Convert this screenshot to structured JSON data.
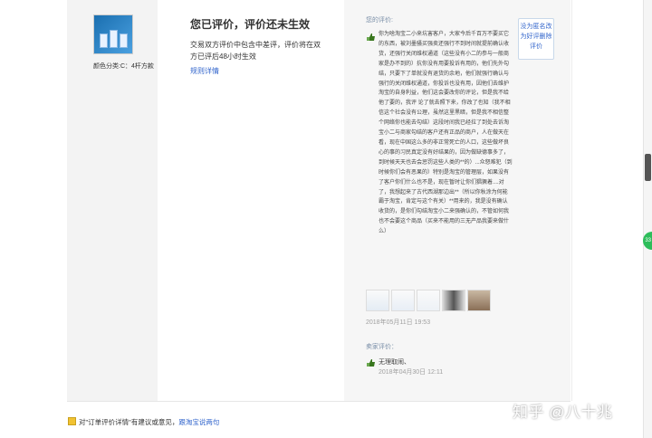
{
  "item": {
    "spec": "颜色分类:C：4杆方款"
  },
  "status": {
    "title": "您已评价，评价还未生效",
    "description": "交易双方评价中包含中差评，评价将在双方已评后48小时生效",
    "rules_link": "规则详情"
  },
  "review": {
    "label": "您的评价:",
    "text": "你为啥淘宝二小来坑害客户，大家今后千百万不要买它的东西，被刘墨骚买强卖还强行不到时间就提前确认收货，还强行关闭维权通道（这些没有小二的参与一般商家是办不到的）抗你没有用要投诉有用的，他们先外勾结，只要下了单就没有退货的余地，他们就强行确认与强行的关闭维权通道，你投诉也没有用，因他们去维护淘宝的自身利益，他们这会要改你的评论，但是我不给他了要的，我评 论了就去照下来，你改了也知（我不相信这个社会没有公理，虽然这里黑暗，但是我不相信整个网络你也能去勾结）这段时间我已经拉了到处去诉淘宝小二与商家勾结的客户还有正品的商户，人在做天在看，现在中国这么多的非正常死亡的人口，这些做坏良心的事的习民真定没有好结果的，因为做缺德事多了，到时候天天也去会惩罚这些人类的**的）...众怒难犯（到时候你们会有恶果的）特别是淘宝的管理层，如果没有了客户你们什么也不是，现在暂时让你们猖獗着....对了，我想起来了古代西湖那边出**（所以你秋涂为何能霸于淘宝，肯定与这个有关）**用来的，我是没有确认收货的，是你们勾结淘宝小二来强确认的，不管如何我也不会要这个商品（买来不能用的三无产品我要来做什么）",
    "side_button": "没为匿名改为好评删除评价",
    "photo_count": 5,
    "date": "2018年05月11日 19:53"
  },
  "seller": {
    "label": "卖家评价：",
    "text": "无理取闹、",
    "date": "2018年04月30日 12:11"
  },
  "footer": {
    "feedback_prefix": "对\"订单评价详情\"有建议或意见，",
    "feedback_link": "跟淘宝说两句"
  },
  "watermark": "知乎 @八十兆",
  "colors": {
    "link": "#3366cc",
    "left_column_bg": "#f3f3f3",
    "right_column_bg": "#f6f6f6",
    "badge_green": "#2dbd5a"
  }
}
